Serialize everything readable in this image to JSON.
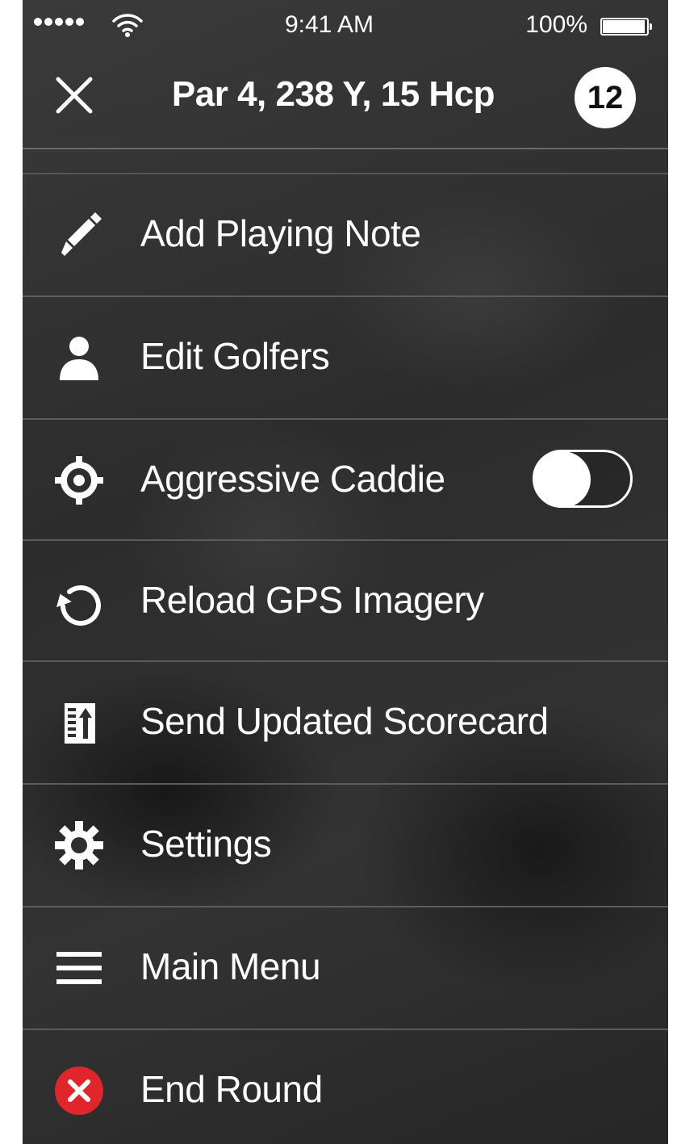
{
  "status_bar": {
    "time": "9:41 AM",
    "battery": "100%",
    "signal_icon": "signal-dots-icon",
    "wifi_icon": "wifi-icon",
    "battery_icon": "battery-icon"
  },
  "header": {
    "title": "Par 4, 238 Y, 15 Hcp",
    "hole_number": "12",
    "close_icon": "close-icon"
  },
  "menu": {
    "items": [
      {
        "id": "add-playing-note",
        "label": "Add Playing Note",
        "icon": "pencil-icon"
      },
      {
        "id": "edit-golfers",
        "label": "Edit Golfers",
        "icon": "person-icon"
      },
      {
        "id": "aggressive-caddie",
        "label": "Aggressive Caddie",
        "icon": "crosshair-icon",
        "toggle": {
          "on": false
        }
      },
      {
        "id": "reload-gps-imagery",
        "label": "Reload GPS Imagery",
        "icon": "reload-icon"
      },
      {
        "id": "send-updated-scorecard",
        "label": "Send Updated Scorecard",
        "icon": "scorecard-upload-icon"
      },
      {
        "id": "settings",
        "label": "Settings",
        "icon": "gear-icon"
      },
      {
        "id": "main-menu",
        "label": "Main Menu",
        "icon": "hamburger-icon"
      },
      {
        "id": "end-round",
        "label": "End Round",
        "icon": "end-round-icon"
      }
    ]
  },
  "colors": {
    "background": "#2e2e2e",
    "text": "#ffffff",
    "divider": "#5c5c5c",
    "end_round_red": "#e0262a"
  }
}
